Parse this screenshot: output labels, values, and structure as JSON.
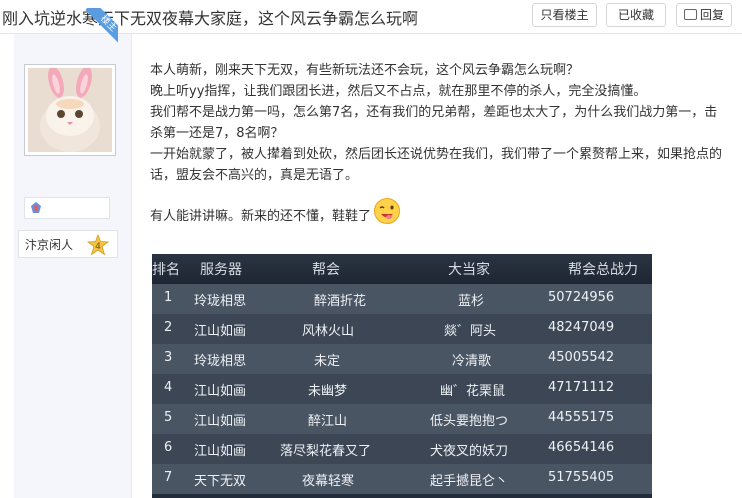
{
  "thread": {
    "title": "刚入坑逆水寒天下无双夜幕大家庭，这个风云争霸怎么玩啊",
    "actions": {
      "only_author": "只看楼主",
      "favorited": "已收藏",
      "reply": "回复"
    }
  },
  "author": {
    "badge": "楼主",
    "rank_title": "汴京闲人",
    "level": "4"
  },
  "post": {
    "lines": [
      "本人萌新，刚来天下无双，有些新玩法还不会玩，这个风云争霸怎么玩啊？",
      "晚上听yy指挥，让我们跟团长进，然后又不占点，就在那里不停的杀人，完全没搞懂。",
      "我们帮不是战力第一吗，怎么第7名，还有我们的兄弟帮，差距也太大了，为什么我们战力第一，击杀第一还是7，8名啊？",
      "一开始就蒙了，被人撵着到处砍，然后团长还说优势在我们，我们带了一个累赘帮上来，如果抢点的话，盟友会不高兴的，真是无语了。",
      "有人能讲讲嘛。新来的还不懂，鞋鞋了"
    ]
  },
  "ranking": {
    "headers": {
      "rank": "排名",
      "server": "服务器",
      "guild": "帮会",
      "leader": "大当家",
      "power": "帮会总战力"
    },
    "rows": [
      {
        "rank": "1",
        "server": "玲珑相思",
        "guild": "醉酒折花",
        "leader": "蓝杉",
        "power": "50724956"
      },
      {
        "rank": "2",
        "server": "江山如画",
        "guild": "风林火山",
        "leader": "燚゛阿头",
        "power": "48247049"
      },
      {
        "rank": "3",
        "server": "玲珑相思",
        "guild": "未定",
        "leader": "冷清歌",
        "power": "45005542"
      },
      {
        "rank": "4",
        "server": "江山如画",
        "guild": "未幽梦",
        "leader": "幽゛花栗鼠",
        "power": "47171112"
      },
      {
        "rank": "5",
        "server": "江山如画",
        "guild": "醉江山",
        "leader": "低头要抱抱つ",
        "power": "44555175"
      },
      {
        "rank": "6",
        "server": "江山如画",
        "guild": "落尽梨花春又了",
        "leader": "犬夜叉的妖刀",
        "power": "46654146"
      },
      {
        "rank": "7",
        "server": "天下无双",
        "guild": "夜幕轻寒",
        "leader": "起手撼昆仑丶",
        "power": "51755405"
      }
    ]
  },
  "colors": {
    "ribbon": "#5b9be0",
    "table_bg": "#232c3a",
    "row_a": "#4a5563",
    "row_b": "#3c4654"
  }
}
